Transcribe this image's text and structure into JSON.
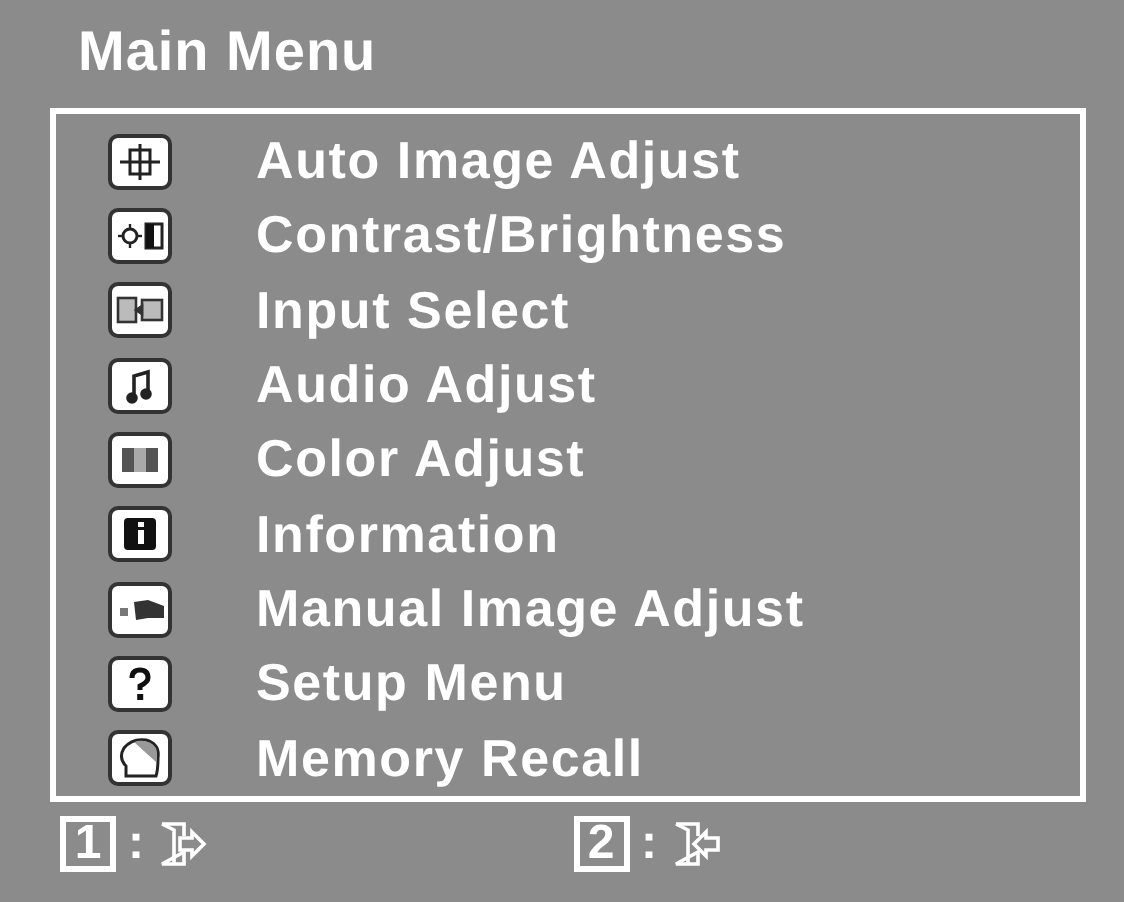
{
  "title": "Main Menu",
  "items": [
    {
      "label": "Auto Image Adjust"
    },
    {
      "label": "Contrast/Brightness"
    },
    {
      "label": "Input Select"
    },
    {
      "label": "Audio Adjust"
    },
    {
      "label": "Color Adjust"
    },
    {
      "label": "Information"
    },
    {
      "label": "Manual Image Adjust"
    },
    {
      "label": "Setup Menu"
    },
    {
      "label": "Memory Recall"
    }
  ],
  "footer": [
    {
      "key": "1",
      "separator": ":"
    },
    {
      "key": "2",
      "separator": ":"
    }
  ]
}
